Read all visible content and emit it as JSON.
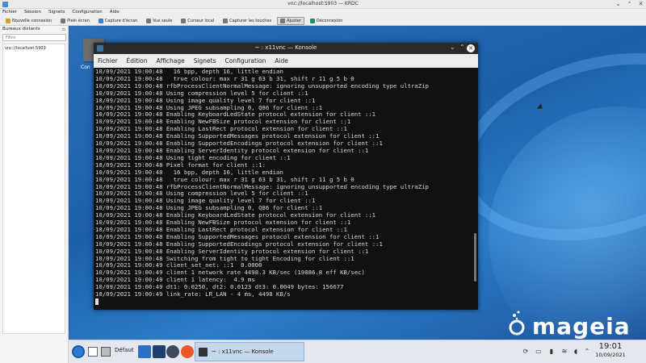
{
  "window": {
    "title": "vnc://localhost:5903 — KRDC",
    "min_glyph": "⌄",
    "max_glyph": "⌃",
    "close_glyph": "✕"
  },
  "menu": [
    "Fichier",
    "Session",
    "Signets",
    "Configuration",
    "Aide"
  ],
  "toolbar": [
    {
      "label": "Nouvelle connexion",
      "icon": "new-connection-icon"
    },
    {
      "label": "Plein écran",
      "icon": "fullscreen-icon"
    },
    {
      "label": "Capture d'écran",
      "icon": "screenshot-icon"
    },
    {
      "label": "Vue seule",
      "icon": "view-only-icon"
    },
    {
      "label": "Curseur local",
      "icon": "local-cursor-icon"
    },
    {
      "label": "Capturer les touches",
      "icon": "grab-keys-icon"
    },
    {
      "label": "Ajuster",
      "icon": "scale-icon",
      "active": true
    },
    {
      "label": "Déconnexion",
      "icon": "disconnect-icon"
    }
  ],
  "sidebar": {
    "title": "Bureaux distants",
    "filter_placeholder": "Filtre",
    "items": [
      "vnc://localhost:5903"
    ]
  },
  "desktop": {
    "brand_text": "mageia"
  },
  "konsole": {
    "title": "~ : x11vnc — Konsole",
    "close_glyph": "✕",
    "menu": [
      "Fichier",
      "Édition",
      "Affichage",
      "Signets",
      "Configuration",
      "Aide"
    ],
    "lines": [
      "10/09/2021 19:00:48   16 bpp, depth 16, little endian",
      "10/09/2021 19:00:48   true colour: max r 31 g 63 b 31, shift r 11 g 5 b 0",
      "10/09/2021 19:00:48 rfbProcessClientNormalMessage: ignoring unsupported encoding type ultraZip",
      "10/09/2021 19:00:48 Using compression level 5 for client ::1",
      "10/09/2021 19:00:48 Using image quality level 7 for client ::1",
      "10/09/2021 19:00:48 Using JPEG subsampling 0, Q86 for client ::1",
      "10/09/2021 19:00:48 Enabling KeyboardLedState protocol extension for client ::1",
      "10/09/2021 19:00:48 Enabling NewFBSize protocol extension for client ::1",
      "10/09/2021 19:00:48 Enabling LastRect protocol extension for client ::1",
      "10/09/2021 19:00:48 Enabling SupportedMessages protocol extension for client ::1",
      "10/09/2021 19:00:48 Enabling SupportedEncodings protocol extension for client ::1",
      "10/09/2021 19:00:48 Enabling ServerIdentity protocol extension for client ::1",
      "10/09/2021 19:00:48 Using tight encoding for client ::1",
      "10/09/2021 19:00:48 Pixel format for client ::1:",
      "10/09/2021 19:00:48   16 bpp, depth 16, little endian",
      "10/09/2021 19:00:48   true colour: max r 31 g 63 b 31, shift r 11 g 5 b 0",
      "10/09/2021 19:00:48 rfbProcessClientNormalMessage: ignoring unsupported encoding type ultraZip",
      "10/09/2021 19:00:48 Using compression level 5 for client ::1",
      "10/09/2021 19:00:48 Using image quality level 7 for client ::1",
      "10/09/2021 19:00:48 Using JPEG subsampling 0, Q86 for client ::1",
      "10/09/2021 19:00:48 Enabling KeyboardLedState protocol extension for client ::1",
      "10/09/2021 19:00:48 Enabling NewFBSize protocol extension for client ::1",
      "10/09/2021 19:00:48 Enabling LastRect protocol extension for client ::1",
      "10/09/2021 19:00:48 Enabling SupportedMessages protocol extension for client ::1",
      "10/09/2021 19:00:48 Enabling SupportedEncodings protocol extension for client ::1",
      "10/09/2021 19:00:48 Enabling ServerIdentity protocol extension for client ::1",
      "10/09/2021 19:00:48 Switching from tight to tight Encoding for client ::1",
      "10/09/2021 19:00:49 client_set_net: ::1  0.0000",
      "10/09/2021 19:00:49 client 1 network rate 4498.3 KB/sec (19086.8 eff KB/sec)",
      "10/09/2021 19:00:49 client 1 latency:  4.9 ms",
      "10/09/2021 19:00:49 dt1: 0.0250, dt2: 0.0123 dt3: 0.0049 bytes: 156677",
      "10/09/2021 19:00:49 link_rate: LR_LAN - 4 ms, 4498 KB/s"
    ]
  },
  "taskbar": {
    "pager_label": "Défaut",
    "task_label": "~ : x11vnc — Konsole",
    "time": "19:01",
    "date": "10/09/2021"
  }
}
